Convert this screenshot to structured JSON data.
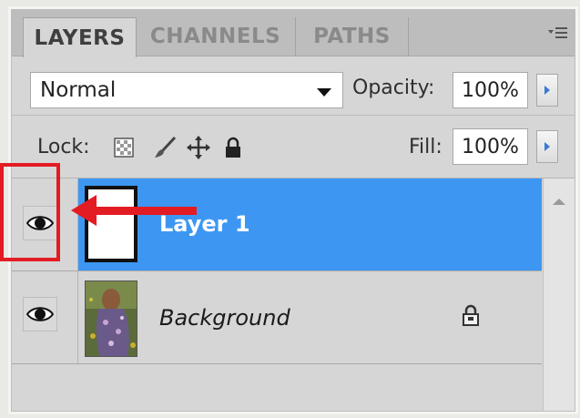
{
  "tabs": [
    {
      "label": "LAYERS",
      "active": true
    },
    {
      "label": "CHANNELS",
      "active": false
    },
    {
      "label": "PATHS",
      "active": false
    }
  ],
  "panel_menu_icon": "panel-menu-icon",
  "blend_mode": {
    "value": "Normal"
  },
  "opacity": {
    "label": "Opacity:",
    "value": "100%"
  },
  "lock": {
    "label": "Lock:",
    "icons": [
      "lock-transparent-pixels-icon",
      "lock-image-pixels-icon",
      "lock-position-icon",
      "lock-all-icon"
    ]
  },
  "fill": {
    "label": "Fill:",
    "value": "100%"
  },
  "layers": [
    {
      "name": "Layer 1",
      "selected": true,
      "visible": true,
      "locked": false
    },
    {
      "name": "Background",
      "selected": false,
      "visible": true,
      "locked": true
    }
  ],
  "colors": {
    "selected_row": "#3d97f2",
    "annotation": "#e31b23",
    "panel_bg": "#d6d6d6"
  }
}
